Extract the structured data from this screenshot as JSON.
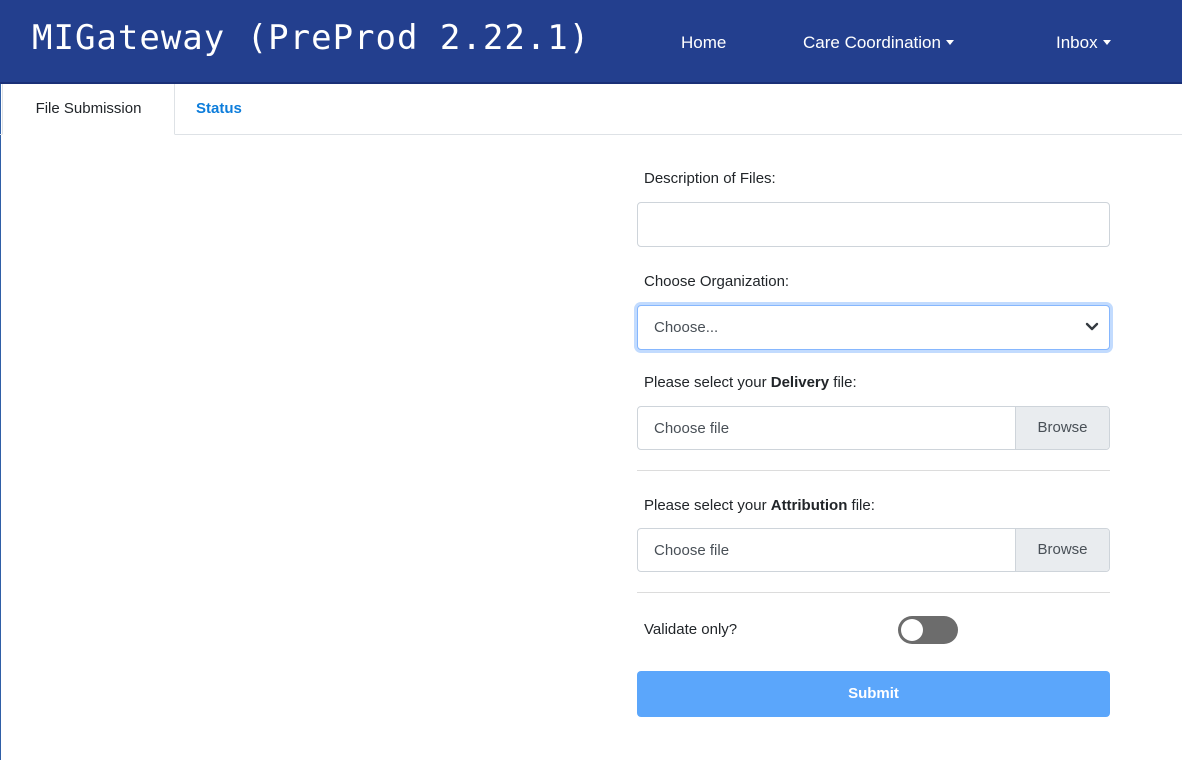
{
  "app": {
    "brand": "MIGateway (PreProd 2.22.1)",
    "nav": {
      "home": "Home",
      "care_coordination": "Care Coordination",
      "inbox": "Inbox"
    },
    "colors": {
      "navbar": "#233f8e",
      "accent_link": "#0d7ddb",
      "submit_button": "#5ba6fb",
      "toggle_off": "#6c6c6c"
    }
  },
  "tabs": [
    {
      "label": "File Submission",
      "active": true
    },
    {
      "label": "Status",
      "active": false
    }
  ],
  "form": {
    "description_label": "Description of Files:",
    "description_value": "",
    "organization_label": "Choose Organization:",
    "organization_selected": "Choose...",
    "delivery": {
      "label_prefix": "Please select your ",
      "label_bold": "Delivery",
      "label_suffix": " file:",
      "placeholder": "Choose file",
      "browse": "Browse"
    },
    "attribution": {
      "label_prefix": "Please select your ",
      "label_bold": "Attribution",
      "label_suffix": " file:",
      "placeholder": "Choose file",
      "browse": "Browse"
    },
    "validate_label": "Validate only?",
    "validate_checked": false,
    "submit": "Submit"
  },
  "icons": {
    "dropdown_caret": "caret-down-icon",
    "select_chevron": "chevron-down-icon"
  }
}
